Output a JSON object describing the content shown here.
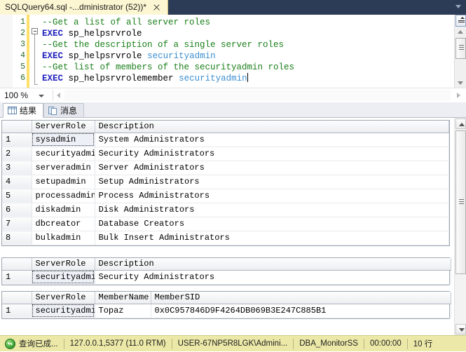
{
  "window": {
    "tab": {
      "title": "SQLQuery64.sql -...dministrator (52))*",
      "close_icon": "close-icon",
      "overflow_icon": "chevron-down-icon"
    }
  },
  "editor": {
    "zoom_level": "100 %",
    "line_numbers": [
      "1",
      "2",
      "3",
      "4",
      "5",
      "6"
    ],
    "lines": [
      {
        "comment": "--Get a list of all server roles"
      },
      {
        "keyword": "EXEC",
        "proc": "sp_helpsrvrole"
      },
      {
        "comment": "--Get the description of a single server roles"
      },
      {
        "keyword": "EXEC",
        "proc": "sp_helpsrvrole",
        "arg": "securityadmin"
      },
      {
        "comment": "--Get list of members of the securityadmin roles"
      },
      {
        "keyword": "EXEC",
        "proc": "sp_helpsrvrolemember",
        "arg": "securityadmin"
      }
    ]
  },
  "result_tabs": [
    {
      "label": "结果",
      "icon": "grid-icon",
      "selected": true
    },
    {
      "label": "消息",
      "icon": "message-icon",
      "selected": false
    }
  ],
  "grids": [
    {
      "name": "server-roles-grid",
      "columns": [
        "",
        "ServerRole",
        "Description"
      ],
      "rows": [
        {
          "n": "1",
          "ServerRole": "sysadmin",
          "Description": "System Administrators"
        },
        {
          "n": "2",
          "ServerRole": "securityadmin",
          "Description": "Security Administrators"
        },
        {
          "n": "3",
          "ServerRole": "serveradmin",
          "Description": "Server Administrators"
        },
        {
          "n": "4",
          "ServerRole": "setupadmin",
          "Description": "Setup Administrators"
        },
        {
          "n": "5",
          "ServerRole": "processadmin",
          "Description": "Process Administrators"
        },
        {
          "n": "6",
          "ServerRole": "diskadmin",
          "Description": "Disk Administrators"
        },
        {
          "n": "7",
          "ServerRole": "dbcreator",
          "Description": "Database Creators"
        },
        {
          "n": "8",
          "ServerRole": "bulkadmin",
          "Description": "Bulk Insert Administrators"
        }
      ]
    },
    {
      "name": "single-role-grid",
      "columns": [
        "",
        "ServerRole",
        "Description"
      ],
      "rows": [
        {
          "n": "1",
          "ServerRole": "securityadmin",
          "Description": "Security Administrators"
        }
      ]
    },
    {
      "name": "role-members-grid",
      "columns": [
        "",
        "ServerRole",
        "MemberName",
        "MemberSID"
      ],
      "rows": [
        {
          "n": "1",
          "ServerRole": "securityadmin",
          "MemberName": "Topaz",
          "MemberSID": "0x0C957846D9F4264DB069B3E247C885B1"
        }
      ]
    }
  ],
  "statusbar": {
    "status_icon": "success-check-icon",
    "status_text": "查询已成...",
    "server": "127.0.0.1,5377 (11.0 RTM)",
    "user": "USER-67NP5R8LGK\\Admini...",
    "database": "DBA_MonitorSS",
    "elapsed": "00:00:00",
    "rows": "10 行"
  }
}
